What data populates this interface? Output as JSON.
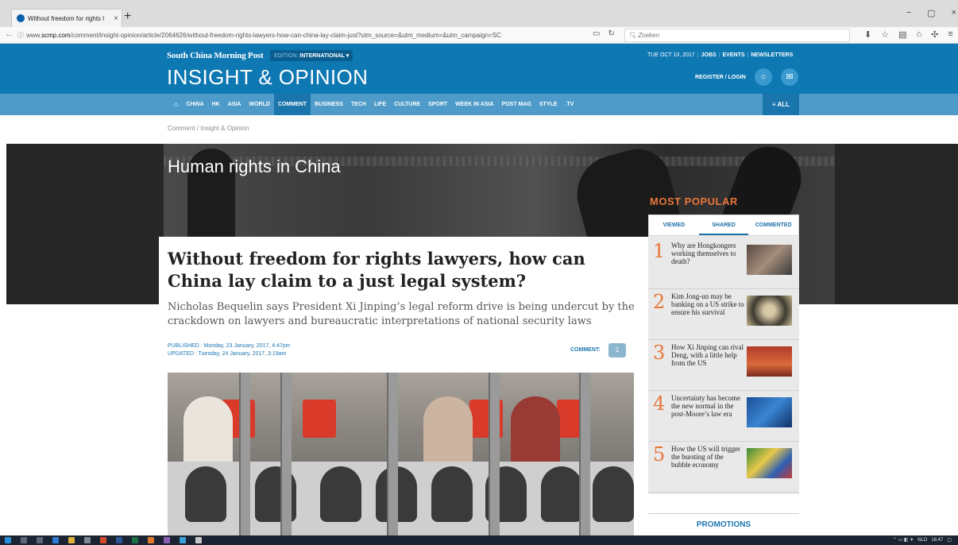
{
  "browser": {
    "tab_title": "Without freedom for rights l",
    "tab_close": "×",
    "new_tab": "+",
    "window_controls": [
      "−",
      "▢",
      "×"
    ],
    "url_prefix": "www.",
    "url_domain": "scmp.com",
    "url_path": "/comment/insight-opinion/article/2064626/without-freedom-rights-lawyers-how-can-china-lay-claim-just?utm_source=&utm_medium=&utm_campaign=SC",
    "search_placeholder": "Zoeken"
  },
  "header": {
    "brand": "South China Morning Post",
    "edition_label": "EDITION:",
    "edition_value": "INTERNATIONAL ▾",
    "section_title": "INSIGHT & OPINION",
    "date": "TUE OCT 10, 2017",
    "top_links": [
      "JOBS",
      "EVENTS",
      "NEWSLETTERS"
    ],
    "register_login": "REGISTER / LOGIN"
  },
  "nav": {
    "items": [
      "CHINA",
      "HK",
      "ASIA",
      "WORLD",
      "COMMENT",
      "BUSINESS",
      "TECH",
      "LIFE",
      "CULTURE",
      "SPORT",
      "WEEK IN ASIA",
      "POST MAG",
      "STYLE",
      ".TV"
    ],
    "active": "COMMENT",
    "all_label": "≡ ALL"
  },
  "breadcrumb": "Comment / Insight & Opinion",
  "banner": {
    "topic": "Human rights in China"
  },
  "article": {
    "headline": "Without freedom for rights lawyers, how can China lay claim to a just legal system?",
    "subhead": "Nicholas Bequelin says President Xi Jinping’s legal reform drive is being undercut by the crackdown on lawyers and bureaucratic interpretations of national security laws",
    "published": "PUBLISHED : Monday, 23 January, 2017, 4:47pm",
    "updated": "UPDATED : Tuesday, 24 January, 2017, 3:19am",
    "comment_label": "COMMENT:",
    "comment_count": "1"
  },
  "most_popular": {
    "title": "MOST POPULAR",
    "tabs": [
      "VIEWED",
      "SHARED",
      "COMMENTED"
    ],
    "active_tab": "SHARED",
    "items": [
      {
        "num": "1",
        "text": "Why are Hongkongers working themselves to death?"
      },
      {
        "num": "2",
        "text": "Kim Jong-un may be banking on a US strike to ensure his survival"
      },
      {
        "num": "3",
        "text": "How Xi Jinping can rival Deng, with a little help from the US"
      },
      {
        "num": "4",
        "text": "Uncertainty has become the new normal in the post-Moore’s law era"
      },
      {
        "num": "5",
        "text": "How the US will trigger the bursting of the bubble economy"
      }
    ]
  },
  "promotions": "PROMOTIONS",
  "taskbar": {
    "lang": "NLD",
    "time": "16:47"
  },
  "colors": {
    "header_blue": "#0e78b3",
    "menu_blue": "#4e9bc9",
    "accent_orange": "#e8763a"
  }
}
